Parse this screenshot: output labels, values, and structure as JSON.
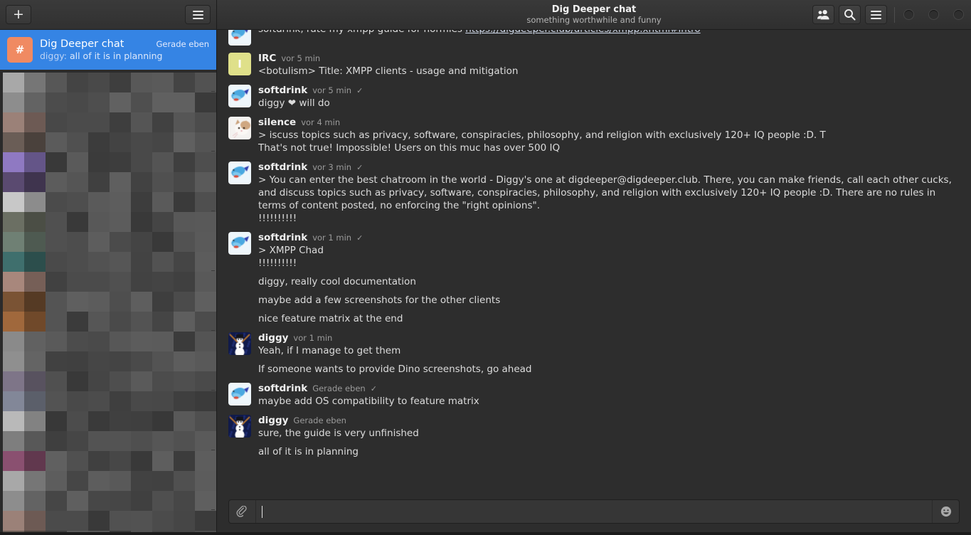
{
  "window": {
    "title": "Dig Deeper chat",
    "subtitle": "something worthwhile and funny",
    "controls": [
      "minimize",
      "maximize",
      "close"
    ]
  },
  "sidebar": {
    "add_button_label": "+",
    "menu_button_label": "☰",
    "selected_chat": {
      "avatar_letter": "#",
      "avatar_color": "#f08a62",
      "name": "Dig Deeper chat",
      "time": "Gerade eben",
      "preview_author": "diggy:",
      "preview_text": "all of it is in planning",
      "selected_color": "#3584e4"
    },
    "hidden_chats_note": "censored chat list (pixelated)"
  },
  "header_actions": [
    {
      "name": "members-icon",
      "label": "Members"
    },
    {
      "name": "search-icon",
      "label": "Search"
    },
    {
      "name": "menu-icon",
      "label": "Menu"
    }
  ],
  "messages": [
    {
      "id": "m0",
      "clipped": true,
      "author": "softdrink",
      "time": "",
      "check": "",
      "avatar": "dolphin",
      "lines": [
        {
          "text": "softdrink, rate my xmpp guide for normies https://digdeeper.club/articles/xmpp.xhtml#intro",
          "link": "https://digdeeper.club/articles/xmpp.xhtml#intro"
        }
      ]
    },
    {
      "id": "m1",
      "author": "IRC",
      "time": "vor 5 min",
      "check": "",
      "avatar": "letter-I",
      "avatar_color": "#dfe08a",
      "lines": [
        {
          "text": "<botulism> Title: XMPP clients - usage and mitigation"
        }
      ]
    },
    {
      "id": "m2",
      "author": "softdrink",
      "time": "vor 5 min",
      "check": "✓",
      "avatar": "dolphin",
      "lines": [
        {
          "text": "diggy ❤ will do"
        }
      ]
    },
    {
      "id": "m3",
      "author": "silence",
      "time": "vor 4 min",
      "check": "",
      "avatar": "cat",
      "lines": [
        {
          "text": "> iscuss topics such as privacy, software, conspiracies, philosophy, and religion with exclusively 120+ IQ people :D. T",
          "tight": true
        },
        {
          "text": "That's not true! Impossible! Users on this muc has over 500 IQ",
          "tight": true
        }
      ]
    },
    {
      "id": "m4",
      "author": "softdrink",
      "time": "vor 3 min",
      "check": "✓",
      "avatar": "dolphin",
      "lines": [
        {
          "text": "> You can enter the best chatroom in the world - Diggy's one at digdeeper@digdeeper.club. There, you can make friends, call each other cucks, and discuss topics such as privacy, software, conspiracies, philosophy, and religion with exclusively 120+ IQ people :D. There are no rules in terms of content posted, no enforcing the \"right opinions\".",
          "tight": true
        },
        {
          "text": "!!!!!!!!!!",
          "tight": true
        }
      ]
    },
    {
      "id": "m5",
      "author": "softdrink",
      "time": "vor 1 min",
      "check": "✓",
      "avatar": "dolphin",
      "lines": [
        {
          "text": "> XMPP Chad",
          "tight": true
        },
        {
          "text": "!!!!!!!!!!",
          "tight": true
        },
        {
          "text": "diggy, really cool documentation"
        },
        {
          "text": "maybe add a few screenshots for the other clients"
        },
        {
          "text": "nice feature matrix at the end"
        }
      ]
    },
    {
      "id": "m6",
      "author": "diggy",
      "time": "vor 1 min",
      "check": "",
      "avatar": "snowman",
      "lines": [
        {
          "text": "Yeah, if I manage to get them"
        },
        {
          "text": "If someone wants to provide Dino screenshots, go ahead"
        }
      ]
    },
    {
      "id": "m7",
      "author": "softdrink",
      "time": "Gerade eben",
      "check": "✓",
      "avatar": "dolphin",
      "lines": [
        {
          "text": "maybe add OS compatibility to feature matrix"
        }
      ]
    },
    {
      "id": "m8",
      "author": "diggy",
      "time": "Gerade eben",
      "check": "",
      "avatar": "snowman",
      "lines": [
        {
          "text": "sure, the guide is very unfinished"
        },
        {
          "text": "all of it is in planning"
        }
      ]
    }
  ],
  "composer": {
    "attach_icon": "paperclip-icon",
    "value": "",
    "placeholder": "",
    "emoji_icon": "☺"
  },
  "colors": {
    "accent": "#3584e4",
    "chat_bg": "#2d2d2d",
    "sidebar_bg": "#2b2b2b",
    "titlebar_bg": "#353535",
    "text_primary": "#dcdcdc",
    "text_muted": "#9b9b9b"
  }
}
